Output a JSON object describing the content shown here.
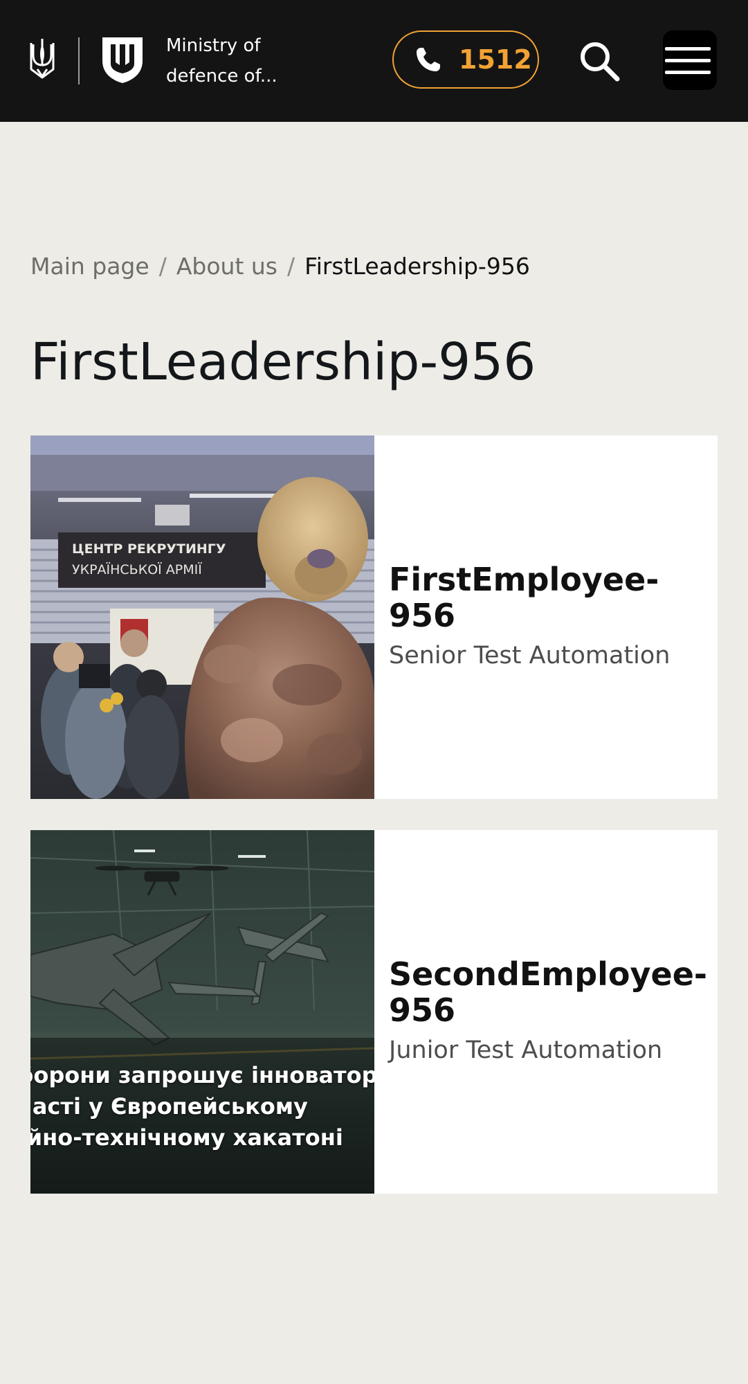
{
  "header": {
    "ministry_name_line1": "Ministry of",
    "ministry_name_line2": "defence of...",
    "phone_number": "1512",
    "accent_color": "#f2a234",
    "background_color": "#141414"
  },
  "breadcrumb": {
    "items": [
      "Main page",
      "About us"
    ],
    "separator": "/",
    "current": "FirstLeadership-956"
  },
  "page": {
    "title": "FirstLeadership-956",
    "background_color": "#edece7"
  },
  "employees": [
    {
      "name": "FirstEmployee-956",
      "position": "Senior Test Automation",
      "photo": "recruiting-center-press-photo",
      "photo_caption_lines": [
        "ЦЕНТР РЕКРУТИНГУ",
        "УКРАЇНСЬКОЇ АРМІЇ"
      ]
    },
    {
      "name": "SecondEmployee-956",
      "position": "Junior Test Automation",
      "photo": "drones-hangar-photo",
      "photo_overlay_lines": [
        "оборони запрошує інноватор",
        "участі у Європейському",
        "ційно-технічному хакатоні"
      ]
    }
  ],
  "icons": {
    "coat_of_arms": "trident-icon",
    "ministry_emblem": "shield-emblem-icon",
    "phone": "phone-icon",
    "search": "search-icon",
    "menu": "hamburger-menu-icon"
  }
}
